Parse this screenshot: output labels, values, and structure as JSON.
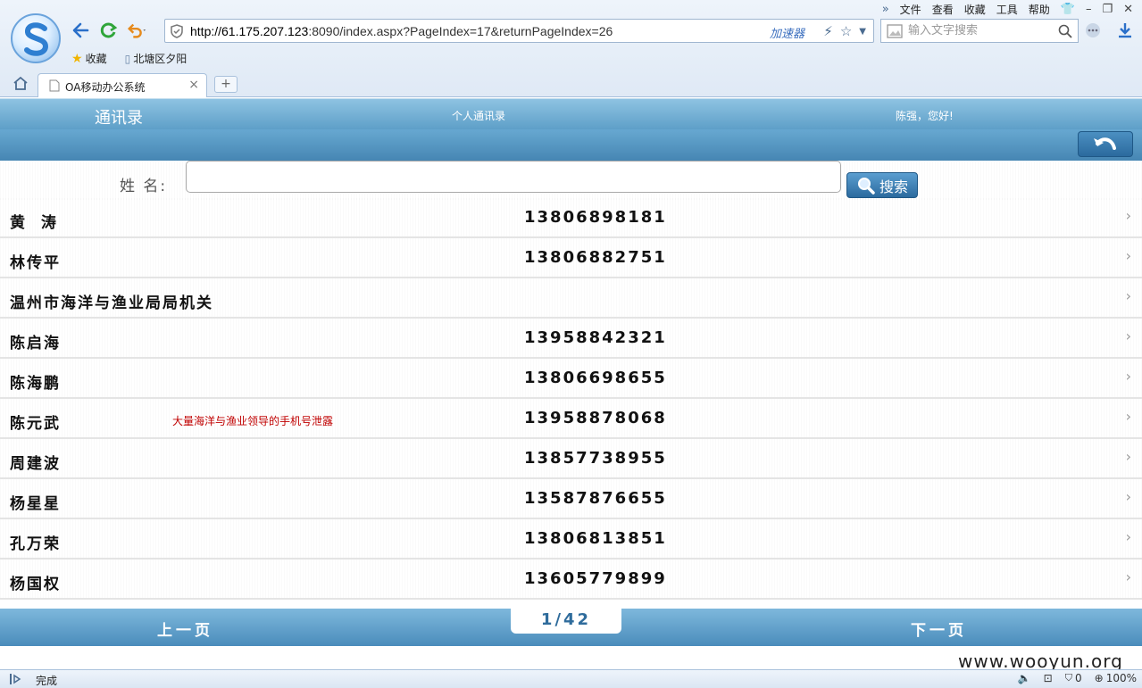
{
  "browser": {
    "url_host": "http://61.175.207.123",
    "url_rest": ":8090/index.aspx?PageIndex=17&returnPageIndex=26",
    "accelerator_label": "加速器",
    "search_placeholder": "输入文字搜索",
    "menu": [
      "文件",
      "查看",
      "收藏",
      "工具",
      "帮助"
    ],
    "bookmarks": [
      {
        "label": "收藏"
      },
      {
        "label": "北塘区夕阳"
      }
    ],
    "tab_title": "OA移动办公系统",
    "new_tab_label": "+",
    "tab_close": "×"
  },
  "header": {
    "title": "通讯录",
    "link": "个人通讯录",
    "greeting": "陈强，您好!"
  },
  "search": {
    "label": "姓 名:",
    "value": "",
    "button_label": "搜索"
  },
  "contacts": [
    {
      "name": "黄  涛",
      "phone": "13806898181"
    },
    {
      "name": "林传平",
      "phone": "13806882751"
    },
    {
      "name": "温州市海洋与渔业局局机关",
      "phone": ""
    },
    {
      "name": "陈启海",
      "phone": "13958842321"
    },
    {
      "name": "陈海鹏",
      "phone": "13806698655"
    },
    {
      "name": "陈元武",
      "phone": "13958878068"
    },
    {
      "name": "周建波",
      "phone": "13857738955"
    },
    {
      "name": "杨星星",
      "phone": "13587876655"
    },
    {
      "name": "孔万荣",
      "phone": "13806813851"
    },
    {
      "name": "杨国权",
      "phone": "13605779899"
    }
  ],
  "annotation": "大量海洋与渔业领导的手机号泄露",
  "pager": {
    "prev": "上一页",
    "indicator": "1/42",
    "next": "下一页"
  },
  "status": {
    "text": "完成",
    "count": "0",
    "zoom": "100%"
  },
  "watermark": "www.wooyun.org",
  "icons": {
    "back": "back-arrow-icon",
    "refresh": "refresh-icon",
    "undo": "undo-icon",
    "chevron": "›"
  }
}
